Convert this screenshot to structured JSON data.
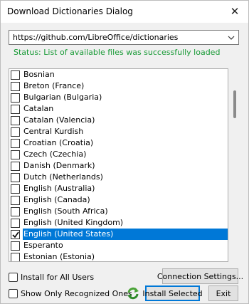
{
  "window": {
    "title": "Download Dictionaries Dialog",
    "close_glyph": "✕"
  },
  "url_combo": {
    "value": "https://github.com/LibreOffice/dictionaries"
  },
  "status": {
    "text": "Status: List of available files was successfully loaded",
    "color": "#189a36"
  },
  "dictionary_list": {
    "items": [
      {
        "label": "Bosnian",
        "checked": false,
        "selected": false
      },
      {
        "label": "Breton (France)",
        "checked": false,
        "selected": false
      },
      {
        "label": "Bulgarian (Bulgaria)",
        "checked": false,
        "selected": false
      },
      {
        "label": "Catalan",
        "checked": false,
        "selected": false
      },
      {
        "label": "Catalan (Valencia)",
        "checked": false,
        "selected": false
      },
      {
        "label": "Central Kurdish",
        "checked": false,
        "selected": false
      },
      {
        "label": "Croatian (Croatia)",
        "checked": false,
        "selected": false
      },
      {
        "label": "Czech (Czechia)",
        "checked": false,
        "selected": false
      },
      {
        "label": "Danish (Denmark)",
        "checked": false,
        "selected": false
      },
      {
        "label": "Dutch (Netherlands)",
        "checked": false,
        "selected": false
      },
      {
        "label": "English (Australia)",
        "checked": false,
        "selected": false
      },
      {
        "label": "English (Canada)",
        "checked": false,
        "selected": false
      },
      {
        "label": "English (South Africa)",
        "checked": false,
        "selected": false
      },
      {
        "label": "English (United Kingdom)",
        "checked": false,
        "selected": false
      },
      {
        "label": "English (United States)",
        "checked": true,
        "selected": true
      },
      {
        "label": "Esperanto",
        "checked": false,
        "selected": false
      },
      {
        "label": "Estonian (Estonia)",
        "checked": false,
        "selected": false
      }
    ],
    "selection_color": "#0078d7"
  },
  "options": {
    "install_all_users_label": "Install for All Users",
    "show_recognized_label": "Show Only Recognized Ones"
  },
  "buttons": {
    "connection_settings": "Connection Settings...",
    "install_selected": "Install Selected",
    "exit": "Exit"
  },
  "icons": {
    "close": "close-icon",
    "dropdown": "chevron-down-icon",
    "check": "checkmark-icon",
    "refresh": "refresh-icon"
  }
}
